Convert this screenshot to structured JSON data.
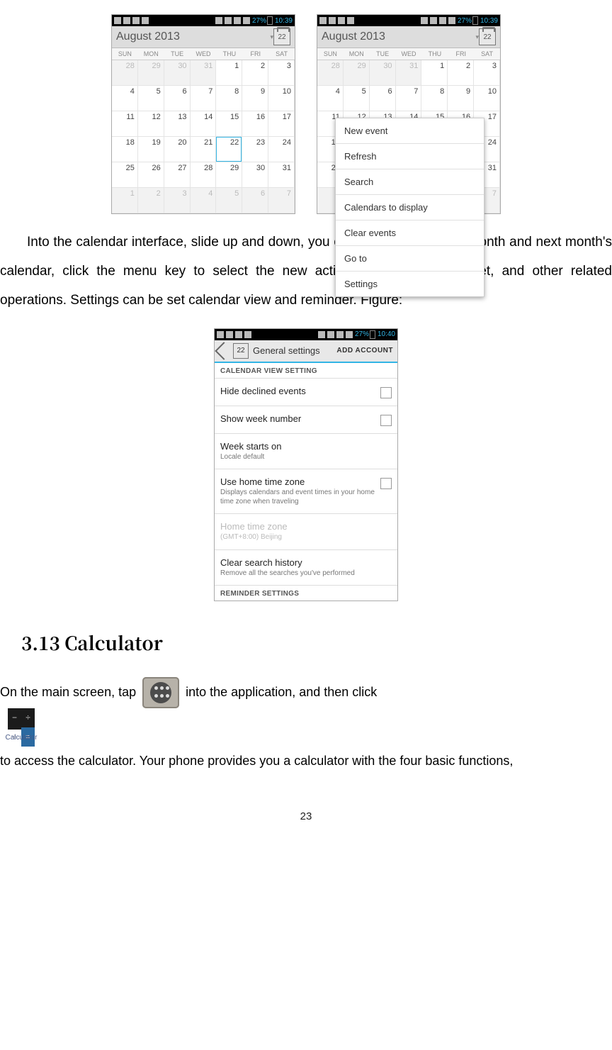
{
  "status_bar": {
    "battery_pct": "27%",
    "time_cal": "10:39",
    "time_set": "10:40"
  },
  "calendar": {
    "title": "August 2013",
    "today_num": "22",
    "dows": [
      "SUN",
      "MON",
      "TUE",
      "WED",
      "THU",
      "FRI",
      "SAT"
    ],
    "rows": [
      [
        {
          "n": "28",
          "o": true
        },
        {
          "n": "29",
          "o": true
        },
        {
          "n": "30",
          "o": true
        },
        {
          "n": "31",
          "o": true
        },
        {
          "n": "1"
        },
        {
          "n": "2"
        },
        {
          "n": "3"
        }
      ],
      [
        {
          "n": "4"
        },
        {
          "n": "5"
        },
        {
          "n": "6"
        },
        {
          "n": "7"
        },
        {
          "n": "8"
        },
        {
          "n": "9"
        },
        {
          "n": "10"
        }
      ],
      [
        {
          "n": "11"
        },
        {
          "n": "12"
        },
        {
          "n": "13"
        },
        {
          "n": "14"
        },
        {
          "n": "15"
        },
        {
          "n": "16"
        },
        {
          "n": "17"
        }
      ],
      [
        {
          "n": "18"
        },
        {
          "n": "19"
        },
        {
          "n": "20"
        },
        {
          "n": "21"
        },
        {
          "n": "22",
          "t": true
        },
        {
          "n": "23"
        },
        {
          "n": "24"
        }
      ],
      [
        {
          "n": "25"
        },
        {
          "n": "26"
        },
        {
          "n": "27"
        },
        {
          "n": "28"
        },
        {
          "n": "29"
        },
        {
          "n": "30"
        },
        {
          "n": "31"
        }
      ],
      [
        {
          "n": "1",
          "o": true
        },
        {
          "n": "2",
          "o": true
        },
        {
          "n": "3",
          "o": true
        },
        {
          "n": "4",
          "o": true
        },
        {
          "n": "5",
          "o": true
        },
        {
          "n": "6",
          "o": true
        },
        {
          "n": "7",
          "o": true
        }
      ]
    ]
  },
  "menu": {
    "items": [
      "New event",
      "Refresh",
      "Search",
      "Calendars to display",
      "Clear events",
      "Go to",
      "Settings"
    ]
  },
  "body": {
    "para1": "Into the calendar interface, slide up and down, you can view the previous month and next month's calendar, click the menu key to select the new activity, refresh, search, set, and other related operations. Settings can be set calendar view and reminder. Figure:"
  },
  "settings": {
    "back_label": "General settings",
    "add_account": "ADD ACCOUNT",
    "section1": "CALENDAR VIEW SETTING",
    "rows": [
      {
        "title": "Hide declined events",
        "checkbox": true
      },
      {
        "title": "Show week number",
        "checkbox": true
      },
      {
        "title": "Week starts on",
        "sub": "Locale default"
      },
      {
        "title": "Use home time zone",
        "sub": "Displays calendars and event times in your home time zone when traveling",
        "checkbox": true
      },
      {
        "title": "Home time zone",
        "sub": "(GMT+8:00) Beijing",
        "disabled": true
      },
      {
        "title": "Clear search history",
        "sub": "Remove all the searches you've performed"
      }
    ],
    "section2": "REMINDER SETTINGS"
  },
  "heading": "3.13 Calculator",
  "calc_para": {
    "p1a": "On the main screen, tap ",
    "p1b": " into the application, and then click ",
    "p1c": " to access the calculator. Your phone provides you a calculator with the four basic functions,",
    "calc_label": "Calculator",
    "sym_minus": "−",
    "sym_div": "÷",
    "sym_plus": "+",
    "sym_eq": "="
  },
  "page_number": "23"
}
